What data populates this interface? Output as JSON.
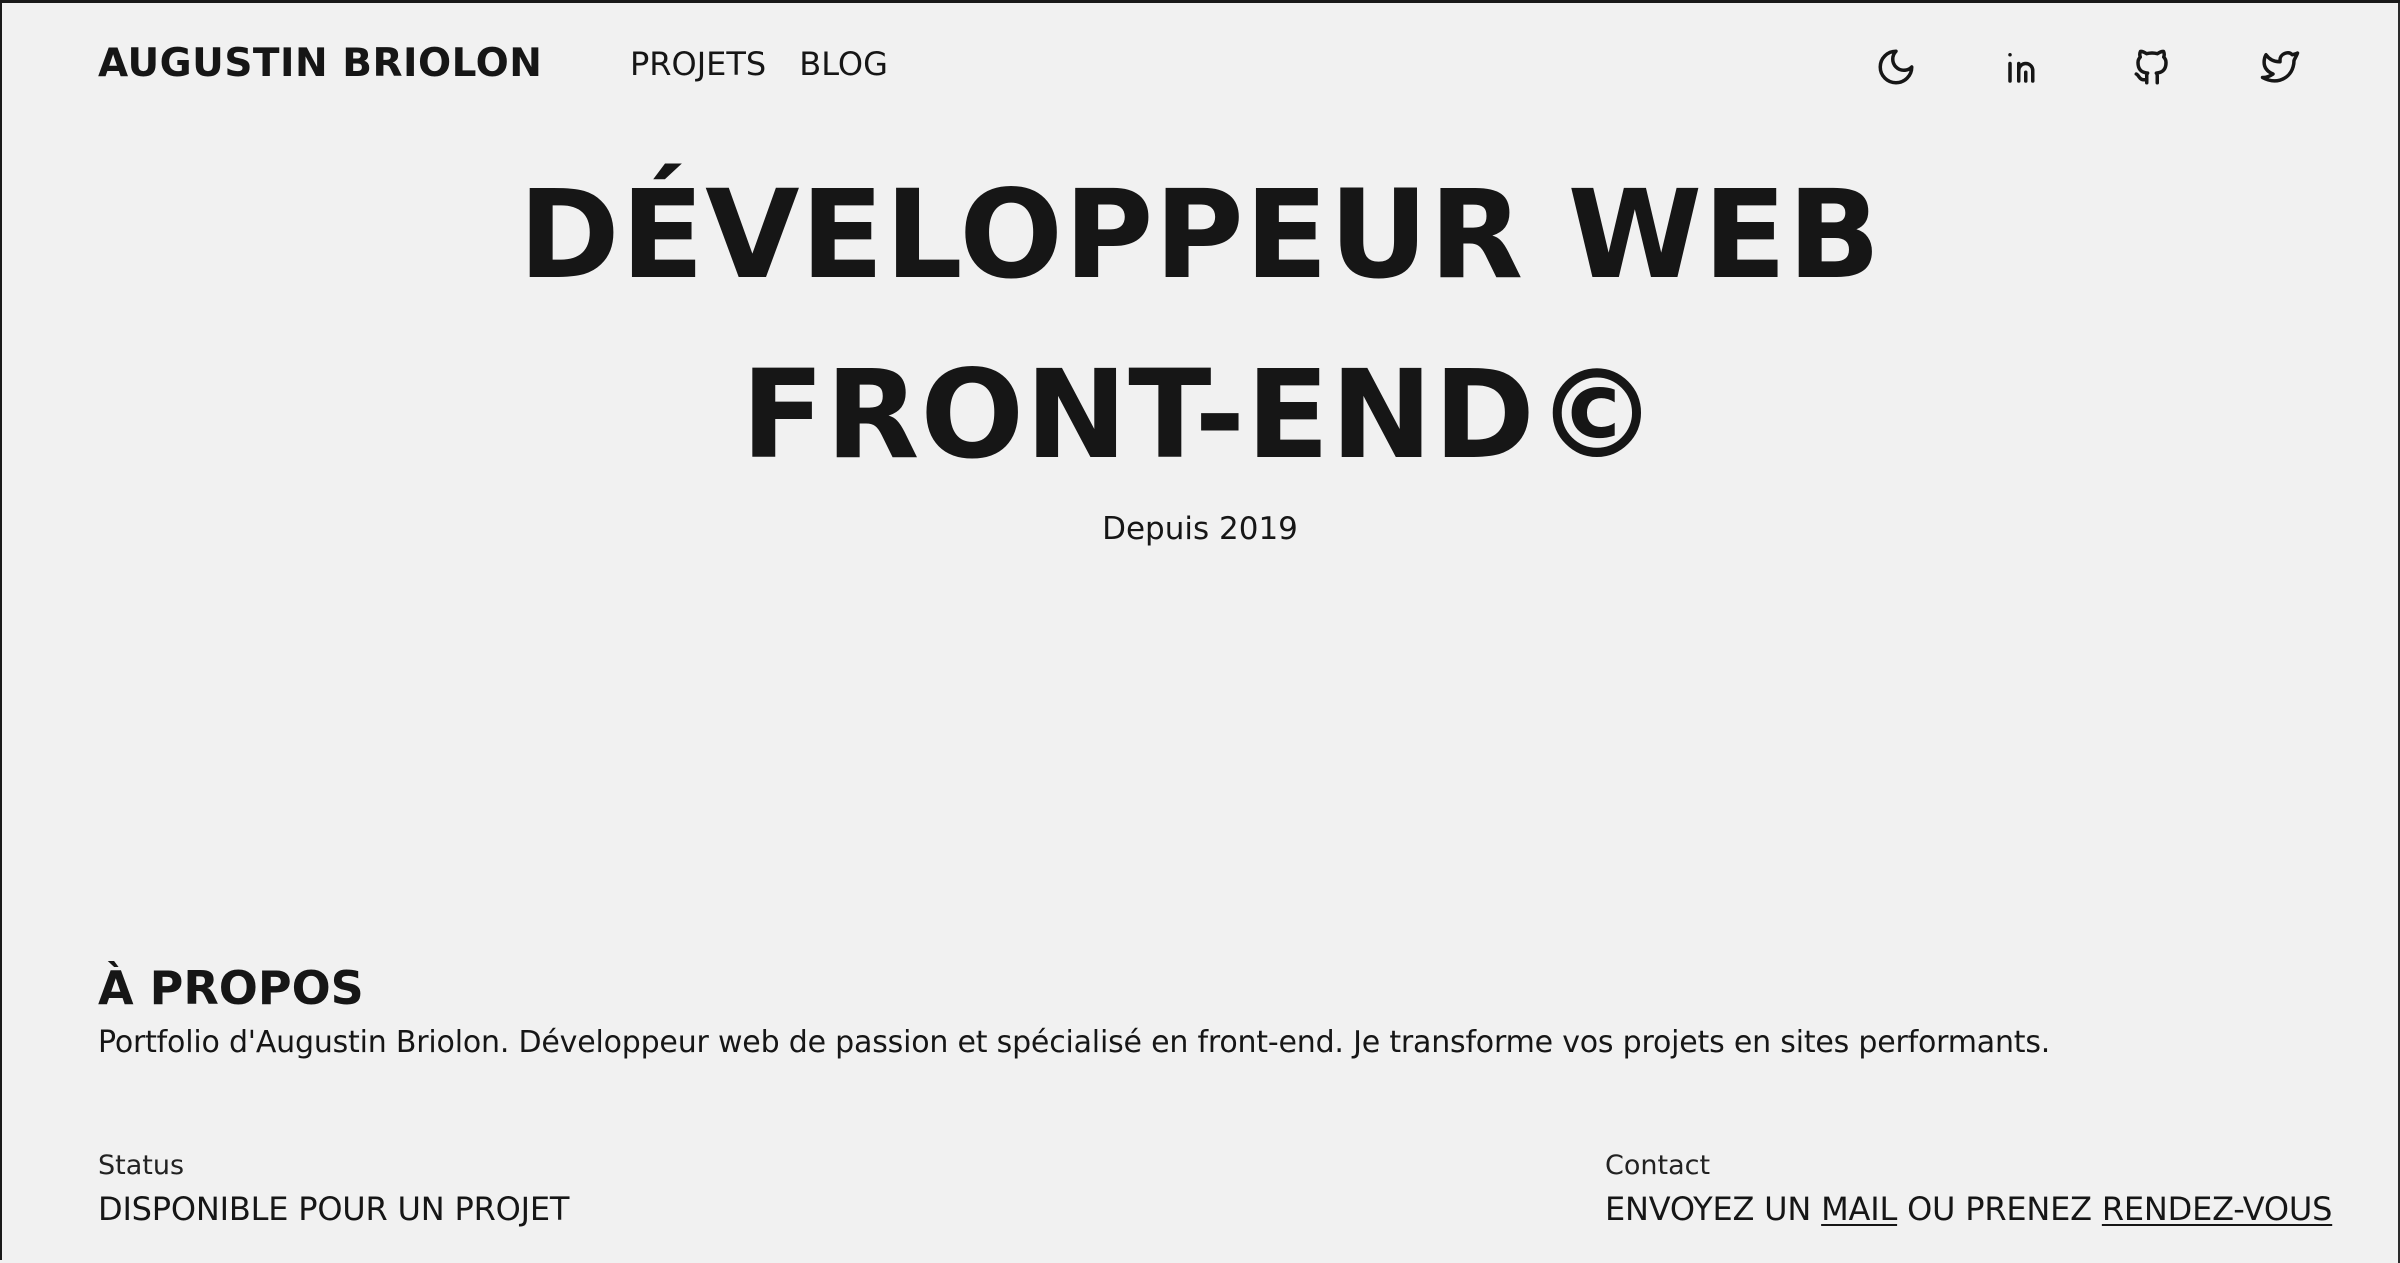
{
  "header": {
    "brand": "AUGUSTIN BRIOLON",
    "nav": [
      {
        "label": "PROJETS"
      },
      {
        "label": "BLOG"
      }
    ],
    "icons": [
      "moon-icon",
      "linkedin-icon",
      "github-icon",
      "twitter-icon"
    ]
  },
  "hero": {
    "line1": "DÉVELOPPEUR WEB",
    "line2": "FRONT-END©",
    "since": "Depuis 2019"
  },
  "about": {
    "title": "À PROPOS",
    "text": "Portfolio d'Augustin Briolon. Développeur web de passion et spécialisé en front-end. Je transforme vos projets en sites performants."
  },
  "status": {
    "label": "Status",
    "value": "DISPONIBLE POUR UN PROJET"
  },
  "contact": {
    "label": "Contact",
    "prefix": "ENVOYEZ UN ",
    "mail_link": "MAIL",
    "middle": " OU PRENEZ ",
    "rdv_link": "RENDEZ-VOUS"
  },
  "colors": {
    "background": "#f1f1f1",
    "text": "#161616"
  }
}
